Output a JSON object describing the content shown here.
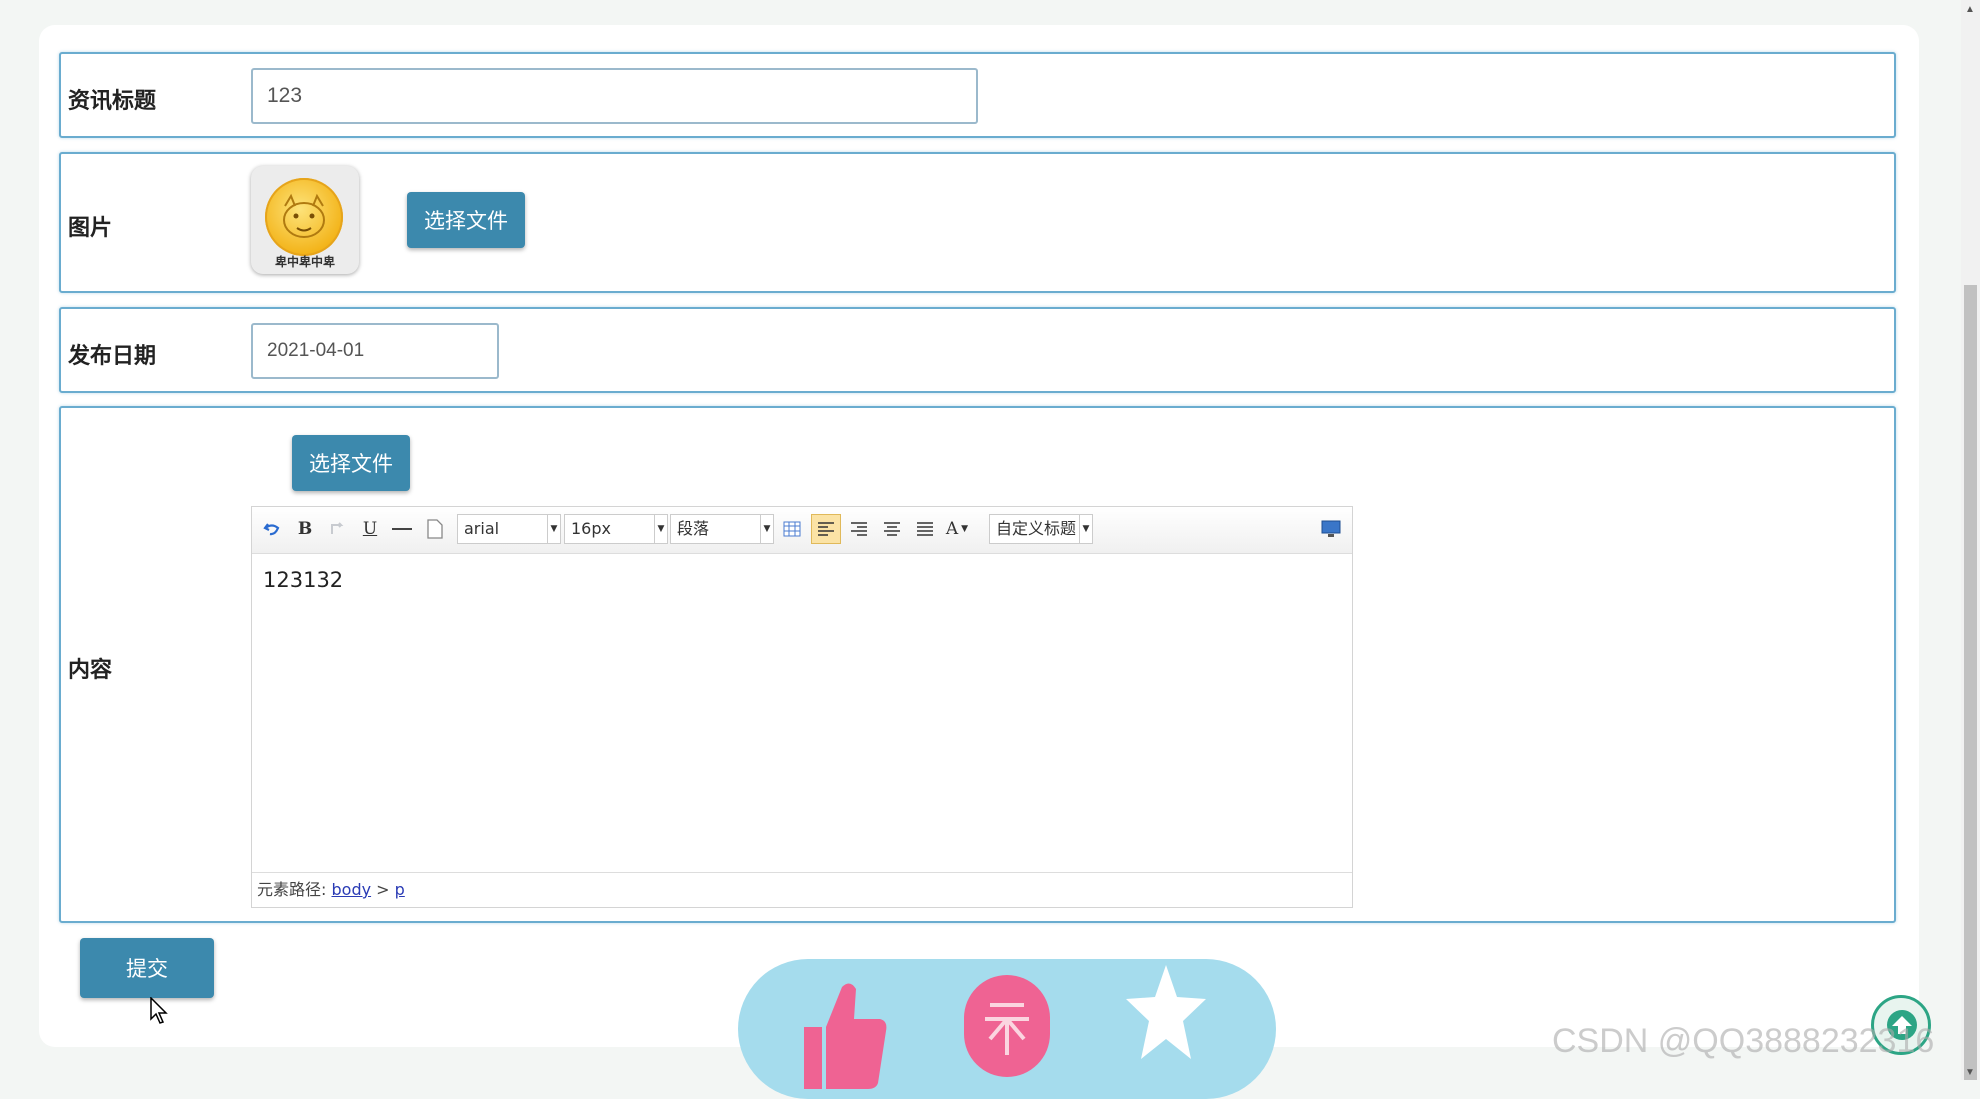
{
  "form": {
    "title_label": "资讯标题",
    "title_value": "123",
    "image_label": "图片",
    "image_caption": "卑中卑中卑",
    "choose_file_label": "选择文件",
    "date_label": "发布日期",
    "date_value": "2021-04-01",
    "content_label": "内容",
    "content_choose_file_label": "选择文件",
    "submit_label": "提交"
  },
  "editor": {
    "font_family": "arial",
    "font_size": "16px",
    "paragraph": "段落",
    "custom_heading": "自定义标题",
    "text_color_icon": "A",
    "bold_icon": "B",
    "underline_icon": "U",
    "body_text": "123132",
    "path_label": "元素路径:",
    "path_body": "body",
    "path_sep": " > ",
    "path_p": "p"
  },
  "icons": [
    "undo-icon",
    "bold-icon",
    "redo-icon",
    "underline-icon",
    "horizontal-rule-icon",
    "page-icon",
    "table-icon",
    "align-left-icon",
    "align-right-icon",
    "align-center-icon",
    "justify-icon",
    "font-color-icon",
    "preview-icon",
    "thumbs-up-icon",
    "coin-icon",
    "star-icon",
    "back-to-top-icon"
  ],
  "colors": {
    "accent": "#3c89ad",
    "row_border": "#6aaccf",
    "fab_bg": "#a5dced",
    "fab_icon_pink": "#ef6393"
  },
  "watermark": "CSDN @QQ3888232316"
}
